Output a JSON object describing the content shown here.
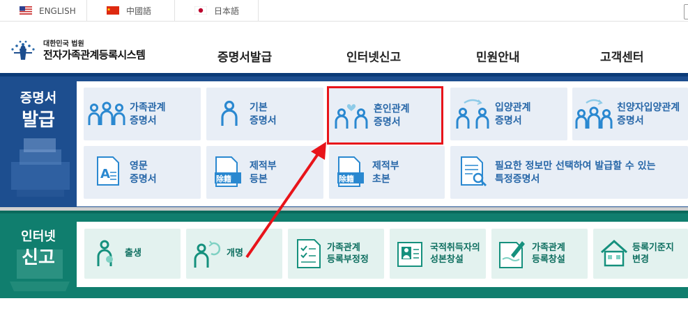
{
  "langbar": {
    "items": [
      {
        "label": "ENGLISH"
      },
      {
        "label": "中國語"
      },
      {
        "label": "日本語"
      }
    ]
  },
  "header": {
    "logo_sub": "대한민국 법원",
    "logo_main": "전자가족관계등록시스템",
    "nav": [
      "증명서발급",
      "인터넷신고",
      "민원안내",
      "고객센터"
    ]
  },
  "cert": {
    "title_line1": "증명서",
    "title_line2": "발급",
    "tiles": [
      {
        "line1": "가족관계",
        "line2": "증명서",
        "icon": "family-icon"
      },
      {
        "line1": "기본",
        "line2": "증명서",
        "icon": "person-icon"
      },
      {
        "line1": "혼인관계",
        "line2": "증명서",
        "icon": "couple-heart-icon"
      },
      {
        "line1": "입양관계",
        "line2": "증명서",
        "icon": "adoption-icon"
      },
      {
        "line1": "친양자입양관계",
        "line2": "증명서",
        "icon": "family-arrow-icon"
      },
      {
        "line1": "영문",
        "line2": "증명서",
        "icon": "english-doc-icon"
      },
      {
        "line1": "제적부",
        "line2": "등본",
        "icon": "removed-doc-icon"
      },
      {
        "line1": "제적부",
        "line2": "초본",
        "icon": "removed-doc-icon"
      },
      {
        "line1": "필요한 정보만 선택하여 발급할 수 있는",
        "line2": "특정증명서",
        "icon": "doc-search-icon"
      }
    ],
    "badge_text": "除籍"
  },
  "report": {
    "title_line1": "인터넷",
    "title_line2": "신고",
    "tiles": [
      {
        "line1": "출생",
        "line2": "",
        "icon": "birth-icon"
      },
      {
        "line1": "개명",
        "line2": "",
        "icon": "rename-icon"
      },
      {
        "line1": "가족관계",
        "line2": "등록부정정",
        "icon": "checklist-icon"
      },
      {
        "line1": "국적취득자의",
        "line2": "성본창설",
        "icon": "id-card-icon"
      },
      {
        "line1": "가족관계",
        "line2": "등록창설",
        "icon": "pen-doc-icon"
      },
      {
        "line1": "등록기준지",
        "line2": "변경",
        "icon": "house-icon"
      }
    ]
  },
  "colors": {
    "cert_bg": "#1d4e8f",
    "report_bg": "#107e6e",
    "highlight": "#e8141a",
    "cert_text": "#2767a8",
    "report_text": "#0e6f60"
  }
}
